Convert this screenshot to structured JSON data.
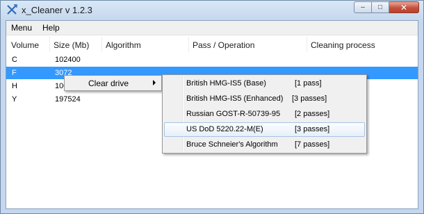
{
  "window": {
    "title": "x_Cleaner v 1.2.3",
    "icon": "x-cleaner-app-icon",
    "controls": {
      "minimize": "–",
      "maximize": "□",
      "close": "✕"
    }
  },
  "menubar": {
    "items": [
      "Menu",
      "Help"
    ]
  },
  "table": {
    "columns": [
      "Volume",
      "Size (Mb)",
      "Algorithm",
      "Pass / Operation",
      "Cleaning process"
    ],
    "rows": [
      {
        "volume": "C",
        "size": "102400",
        "algorithm": "",
        "pass": "",
        "process": ""
      },
      {
        "volume": "F",
        "size": "3072",
        "algorithm": "",
        "pass": "",
        "process": "",
        "selected": true
      },
      {
        "volume": "H",
        "size": "100",
        "algorithm": "",
        "pass": "",
        "process": ""
      },
      {
        "volume": "Y",
        "size": "197524",
        "algorithm": "",
        "pass": "",
        "process": ""
      }
    ]
  },
  "context_menu": {
    "items": [
      {
        "label": "Clear drive",
        "has_submenu": true
      }
    ]
  },
  "submenu": {
    "items": [
      {
        "name": "British HMG-IS5 (Base)",
        "passes": "[1 pass]"
      },
      {
        "name": "British HMG-IS5 (Enhanced)",
        "passes": "[3 passes]"
      },
      {
        "name": "Russian GOST-R-50739-95",
        "passes": "[2 passes]"
      },
      {
        "name": "US DoD 5220.22-M(E)",
        "passes": "[3 passes]",
        "hover": true
      },
      {
        "name": "Bruce Schneier's Algorithm",
        "passes": "[7 passes]"
      }
    ]
  },
  "colors": {
    "selection": "#3399ff",
    "menu_bg": "#f0f0f0",
    "close_button": "#c7513c"
  }
}
